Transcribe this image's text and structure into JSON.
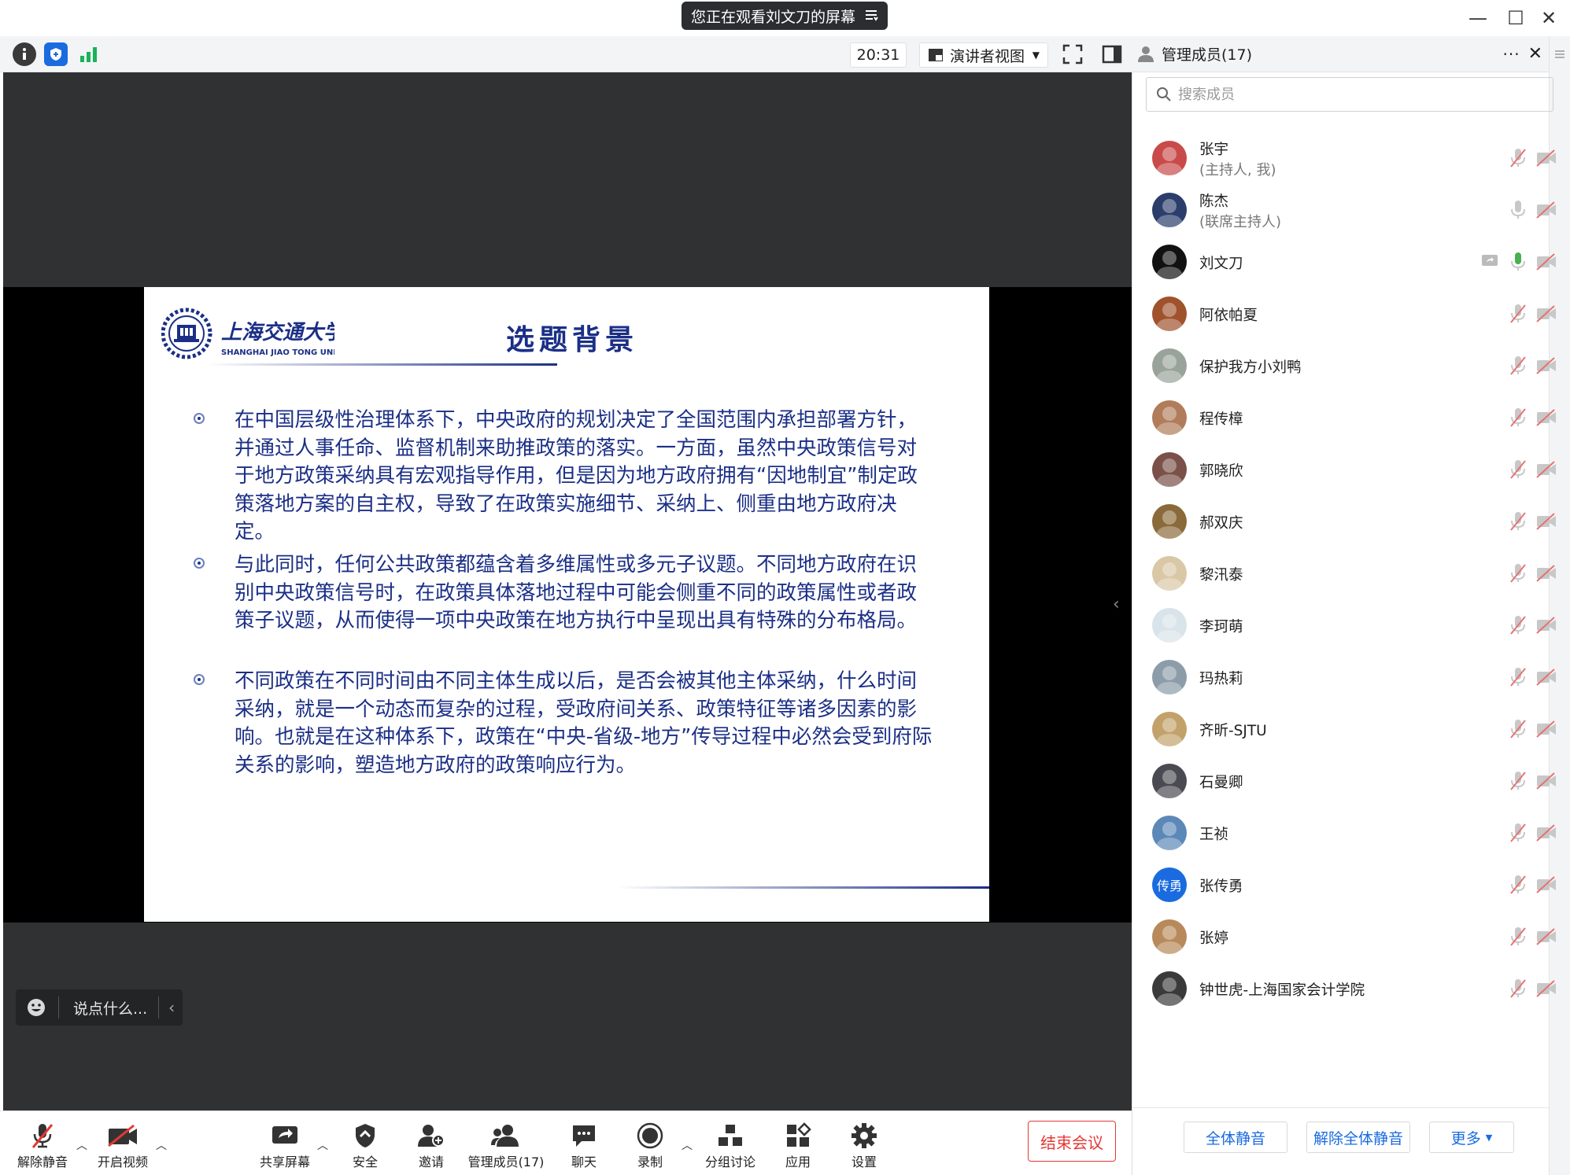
{
  "window": {
    "share_banner": "您正在观看刘文刀的屏幕",
    "controls": {
      "minimize": "—",
      "maximize": "☐",
      "close": "✕"
    }
  },
  "toolbar": {
    "time": "20:31",
    "view_mode": "演讲者视图"
  },
  "slide": {
    "university_cn": "上海交通大学",
    "university_en": "SHANGHAI  JIAO TONG  UNIVERSITY",
    "title": "选题背景",
    "bullets": [
      "在中国层级性治理体系下，中央政府的规划决定了全国范围内承担部署方针，并通过人事任命、监督机制来助推政策的落实。一方面，虽然中央政策信号对于地方政策采纳具有宏观指导作用，但是因为地方政府拥有“因地制宜”制定政策落地方案的自主权，导致了在政策实施细节、采纳上、侧重由地方政府决定。",
      "与此同时，任何公共政策都蕴含着多维属性或多元子议题。不同地方政府在识别中央政策信号时，在政策具体落地过程中可能会侧重不同的政策属性或者政策子议题，从而使得一项中央政策在地方执行中呈现出具有特殊的分布格局。",
      "不同政策在不同时间由不同主体生成以后，是否会被其他主体采纳，什么时间采纳，就是一个动态而复杂的过程，受政府间关系、政策特征等诸多因素的影响。也就是在这种体系下，政策在“中央-省级-地方”传导过程中必然会受到府际关系的影响，塑造地方政府的政策响应行为。"
    ]
  },
  "chat": {
    "placeholder": "说点什么..."
  },
  "bottom_bar": {
    "unmute": "解除静音",
    "start_video": "开启视频",
    "share_screen": "共享屏幕",
    "security": "安全",
    "invite": "邀请",
    "manage_members": "管理成员(17)",
    "chat": "聊天",
    "record": "录制",
    "breakout": "分组讨论",
    "apps": "应用",
    "settings": "设置",
    "end_meeting": "结束会议"
  },
  "panel": {
    "title": "管理成员(17)",
    "search_placeholder": "搜索成员",
    "members": [
      {
        "name": "张宇",
        "role": "(主持人, 我)",
        "avatar": "#c94a4a",
        "mic": "muted",
        "screen": false
      },
      {
        "name": "陈杰",
        "role": "(联席主持人)",
        "avatar": "#2a3d6b",
        "mic": "off",
        "screen": false
      },
      {
        "name": "刘文刀",
        "role": "",
        "avatar": "#111111",
        "mic": "active",
        "screen": true
      },
      {
        "name": "阿依帕夏",
        "role": "",
        "avatar": "#a0522d",
        "mic": "muted",
        "screen": false
      },
      {
        "name": "保护我方小刘鸭",
        "role": "",
        "avatar": "#9aa39a",
        "mic": "muted",
        "screen": false
      },
      {
        "name": "程传樟",
        "role": "",
        "avatar": "#b07c5a",
        "mic": "muted",
        "screen": false
      },
      {
        "name": "郭晓欣",
        "role": "",
        "avatar": "#7a5048",
        "mic": "muted",
        "screen": false
      },
      {
        "name": "郝双庆",
        "role": "",
        "avatar": "#8a6a3a",
        "mic": "muted",
        "screen": false
      },
      {
        "name": "黎汛泰",
        "role": "",
        "avatar": "#d9c7a6",
        "mic": "muted",
        "screen": false
      },
      {
        "name": "李珂萌",
        "role": "",
        "avatar": "#d8e4ea",
        "mic": "muted",
        "screen": false
      },
      {
        "name": "玛热莉",
        "role": "",
        "avatar": "#8c9ca8",
        "mic": "muted",
        "screen": false
      },
      {
        "name": "齐昕-SJTU",
        "role": "",
        "avatar": "#c2a26a",
        "mic": "muted",
        "screen": false
      },
      {
        "name": "石曼卿",
        "role": "",
        "avatar": "#4a4a52",
        "mic": "muted",
        "screen": false
      },
      {
        "name": "王祯",
        "role": "",
        "avatar": "#5c88b8",
        "mic": "muted",
        "screen": false
      },
      {
        "name": "张传勇",
        "role": "",
        "avatar": "#1a6be0",
        "initials": "传勇",
        "mic": "muted",
        "screen": false
      },
      {
        "name": "张婷",
        "role": "",
        "avatar": "#b8895a",
        "mic": "muted",
        "screen": false
      },
      {
        "name": "钟世虎-上海国家会计学院",
        "role": "",
        "avatar": "#3a3a3a",
        "mic": "muted",
        "screen": false
      }
    ],
    "mute_all": "全体静音",
    "unmute_all": "解除全体静音",
    "more": "更多"
  },
  "colors": {
    "accent": "#1a6be0",
    "danger": "#e53935",
    "slide_text": "#1b2f86",
    "stage": "#2f3133"
  }
}
